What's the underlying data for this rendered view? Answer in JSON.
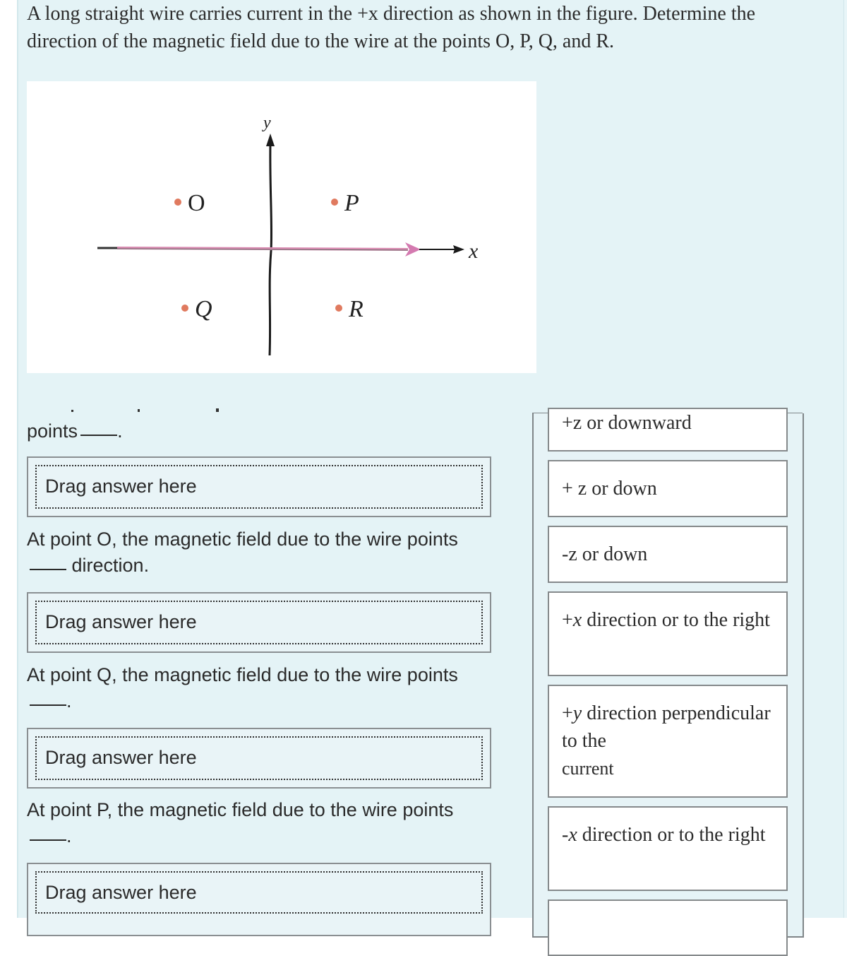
{
  "question": {
    "text": "A long straight wire carries current in the +x direction as shown in the figure. Determine the direction of the magnetic field due to the wire at the points O, P, Q, and R."
  },
  "figure": {
    "axis_x_label": "x",
    "axis_y_label": "y",
    "points": [
      "O",
      "P",
      "Q",
      "R"
    ],
    "point_color": "#e07a5f",
    "wire_color": "#d88ab0"
  },
  "prompts": [
    {
      "pre": "points",
      "post": "."
    },
    {
      "pre": "At point O, the magnetic field due to the wire points",
      "post": "direction."
    },
    {
      "pre": "At point Q, the magnetic field due to the wire points",
      "post": "."
    },
    {
      "pre": "At point P, the magnetic field due to the wire points",
      "post": "."
    }
  ],
  "dropzones": [
    {
      "placeholder": "Drag answer here"
    },
    {
      "placeholder": "Drag answer here"
    },
    {
      "placeholder": "Drag answer here"
    },
    {
      "placeholder": "Drag answer here"
    }
  ],
  "answer_bank": [
    {
      "label": "+z or downward"
    },
    {
      "label": "+ z or down"
    },
    {
      "label": "-z or down"
    },
    {
      "sign": "+",
      "axis": "x",
      "rest": " direction or to the right"
    },
    {
      "sign": "+",
      "axis": "y",
      "rest": " direction perpendicular to the",
      "tail": "current"
    },
    {
      "sign": "-",
      "axis": "x",
      "rest": " direction or to the right"
    },
    {
      "label": ""
    }
  ]
}
